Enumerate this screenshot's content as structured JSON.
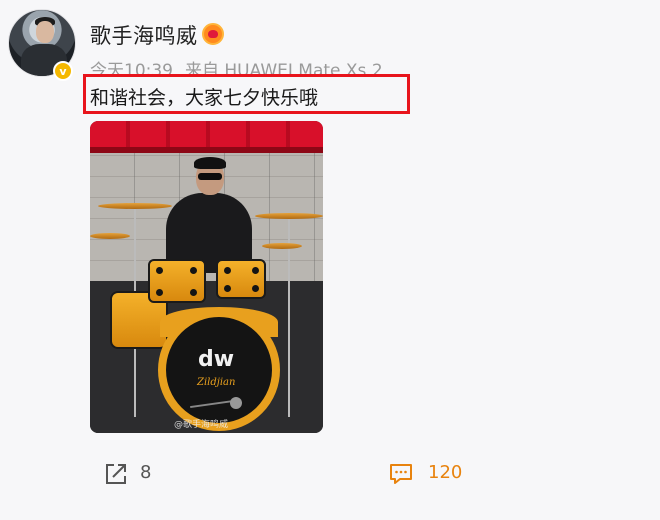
{
  "post": {
    "author": {
      "name": "歌手海鸣威",
      "avatar_icon": "user-avatar",
      "verified_icon": "verified-badge-icon",
      "vip_icon": "vip-heart-icon",
      "verify_glyph": "v"
    },
    "meta": {
      "time": "今天10:39",
      "source": "来自 HUAWEI Mate Xs 2"
    },
    "text": "和谐社会，大家七夕快乐哦",
    "highlight_color": "#e8141c",
    "image": {
      "logo_text": "dw",
      "brand_text": "Zildjian",
      "watermark": "@歌手海鸣威"
    },
    "actions": {
      "share_icon": "share-icon",
      "share_count": "8",
      "comment_icon": "comment-icon",
      "comment_count": "120",
      "comment_color": "#e8830e"
    }
  }
}
